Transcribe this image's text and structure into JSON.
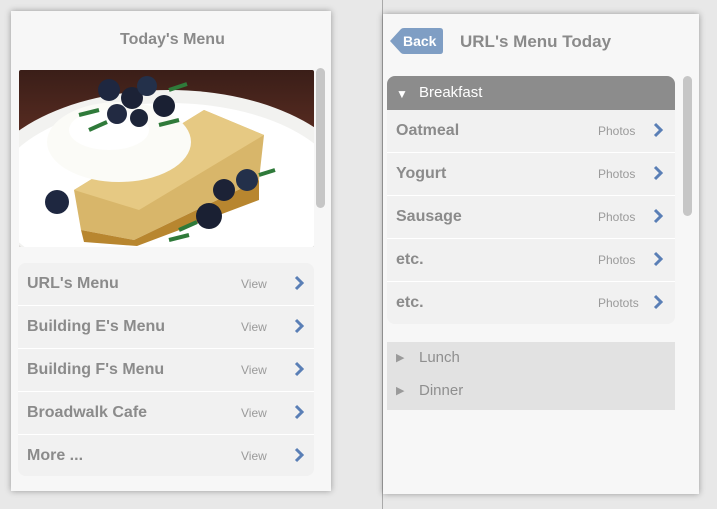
{
  "left_screen": {
    "title": "Today's Menu",
    "menu_items": [
      {
        "label": "URL's Menu",
        "action": "View"
      },
      {
        "label": "Building E's Menu",
        "action": "View"
      },
      {
        "label": "Building F's Menu",
        "action": "View"
      },
      {
        "label": "Broadwalk Cafe",
        "action": "View"
      },
      {
        "label": "More ...",
        "action": "View"
      }
    ]
  },
  "right_screen": {
    "back_label": "Back",
    "title": "URL's Menu Today",
    "expanded_section": {
      "label": "Breakfast",
      "items": [
        {
          "label": "Oatmeal",
          "action": "Photos"
        },
        {
          "label": "Yogurt",
          "action": "Photos"
        },
        {
          "label": "Sausage",
          "action": "Photos"
        },
        {
          "label": "etc.",
          "action": "Photos"
        },
        {
          "label": "etc.",
          "action": "Photots"
        }
      ]
    },
    "collapsed_sections": [
      {
        "label": "Lunch"
      },
      {
        "label": "Dinner"
      }
    ]
  },
  "colors": {
    "accent_blue": "#5a7fb6",
    "back_button": "#7f9ec4",
    "section_header": "#8c8c8c"
  }
}
